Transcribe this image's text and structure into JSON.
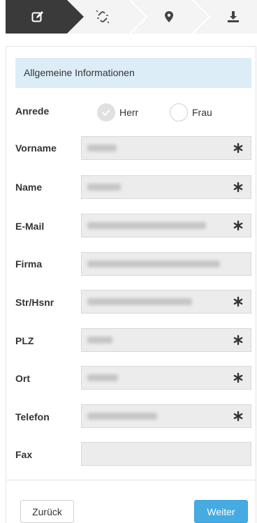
{
  "steps": [
    {
      "icon": "edit-icon",
      "active": true
    },
    {
      "icon": "unlink-icon",
      "active": false
    },
    {
      "icon": "map-marker-icon",
      "active": false
    },
    {
      "icon": "download-icon",
      "active": false
    }
  ],
  "section": {
    "title": "Allgemeine Informationen"
  },
  "salutation": {
    "label": "Anrede",
    "options": [
      {
        "label": "Herr",
        "checked": true
      },
      {
        "label": "Frau",
        "checked": false
      }
    ]
  },
  "fields": [
    {
      "label": "Vorname",
      "required": true
    },
    {
      "label": "Name",
      "required": true
    },
    {
      "label": "E-Mail",
      "required": true
    },
    {
      "label": "Firma",
      "required": false
    },
    {
      "label": "Str/Hsnr",
      "required": true
    },
    {
      "label": "PLZ",
      "required": true
    },
    {
      "label": "Ort",
      "required": true
    },
    {
      "label": "Telefon",
      "required": true
    },
    {
      "label": "Fax",
      "required": false
    }
  ],
  "buttons": {
    "back": "Zurück",
    "next": "Weiter"
  },
  "colors": {
    "active_step": "#3a3a3a",
    "inactive_step": "#f2f2f2",
    "accent": "#45abe2",
    "section_bg": "#dcedf8"
  }
}
